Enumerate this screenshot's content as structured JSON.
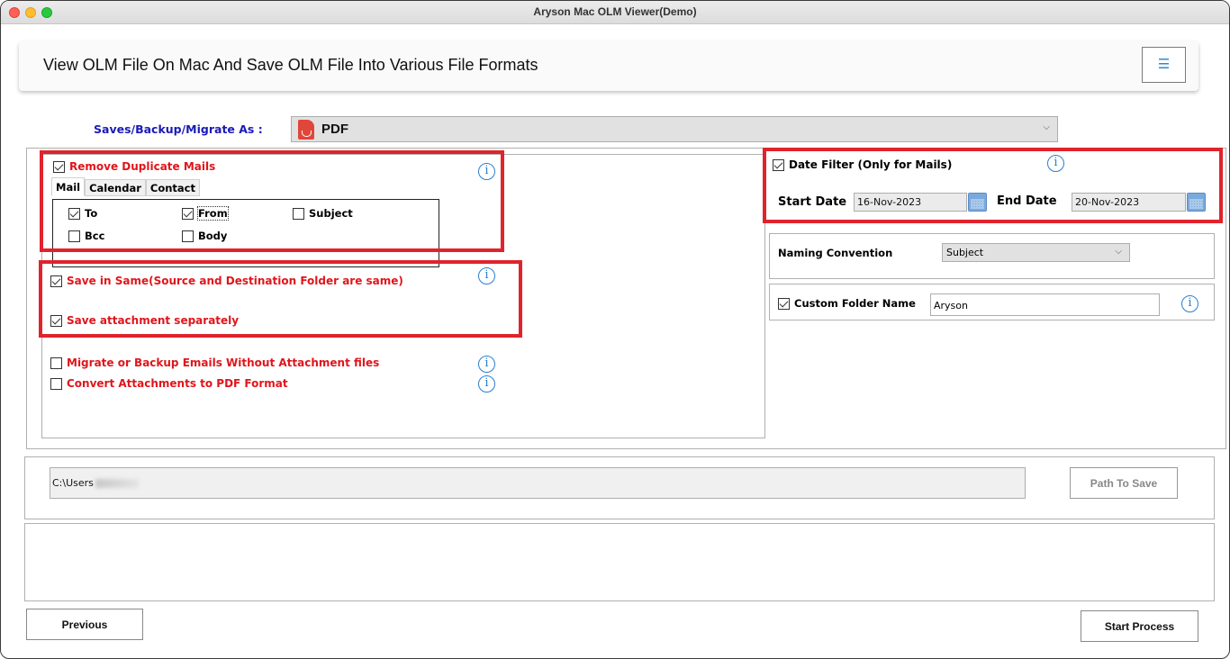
{
  "window": {
    "title": "Aryson Mac OLM Viewer(Demo)"
  },
  "header": {
    "title": "View OLM File On Mac And Save OLM File Into Various File Formats",
    "menu_icon": "hamburger-menu-icon",
    "menu_glyph": "☰"
  },
  "format": {
    "label": "Saves/Backup/Migrate As :",
    "selected": "PDF",
    "icon": "pdf-file-icon",
    "chevron": "⌵"
  },
  "duplicates": {
    "label": "Remove Duplicate Mails",
    "checked": true,
    "tabs": [
      {
        "label": "Mail",
        "active": true
      },
      {
        "label": "Calendar",
        "active": false
      },
      {
        "label": "Contact",
        "active": false
      }
    ],
    "fields": [
      {
        "label": "To",
        "checked": true
      },
      {
        "label": "From",
        "checked": true
      },
      {
        "label": "Subject",
        "checked": false
      },
      {
        "label": "Bcc",
        "checked": false
      },
      {
        "label": "Body",
        "checked": false
      }
    ]
  },
  "options": [
    {
      "label": "Save in Same(Source and Destination Folder are same)",
      "checked": true
    },
    {
      "label": "Save attachment separately",
      "checked": true
    },
    {
      "label": "Migrate or Backup Emails Without Attachment files",
      "checked": false
    },
    {
      "label": "Convert Attachments to PDF Format",
      "checked": false
    }
  ],
  "info_glyph": "i",
  "date_filter": {
    "label": "Date Filter  (Only for Mails)",
    "checked": true,
    "start_label": "Start Date",
    "start_value": "16-Nov-2023",
    "end_label": "End Date",
    "end_value": "20-Nov-2023"
  },
  "naming": {
    "label": "Naming Convention",
    "selected": "Subject"
  },
  "custom_folder": {
    "label": "Custom Folder Name",
    "checked": true,
    "value": "Aryson"
  },
  "path": {
    "value": "C:\\Users",
    "button": "Path To Save"
  },
  "footer": {
    "previous": "Previous",
    "start": "Start Process"
  },
  "colors": {
    "highlight_red": "#e0232c",
    "option_red": "#e0151b",
    "label_blue": "#1a1ab8",
    "info_blue": "#2a7fd0"
  }
}
